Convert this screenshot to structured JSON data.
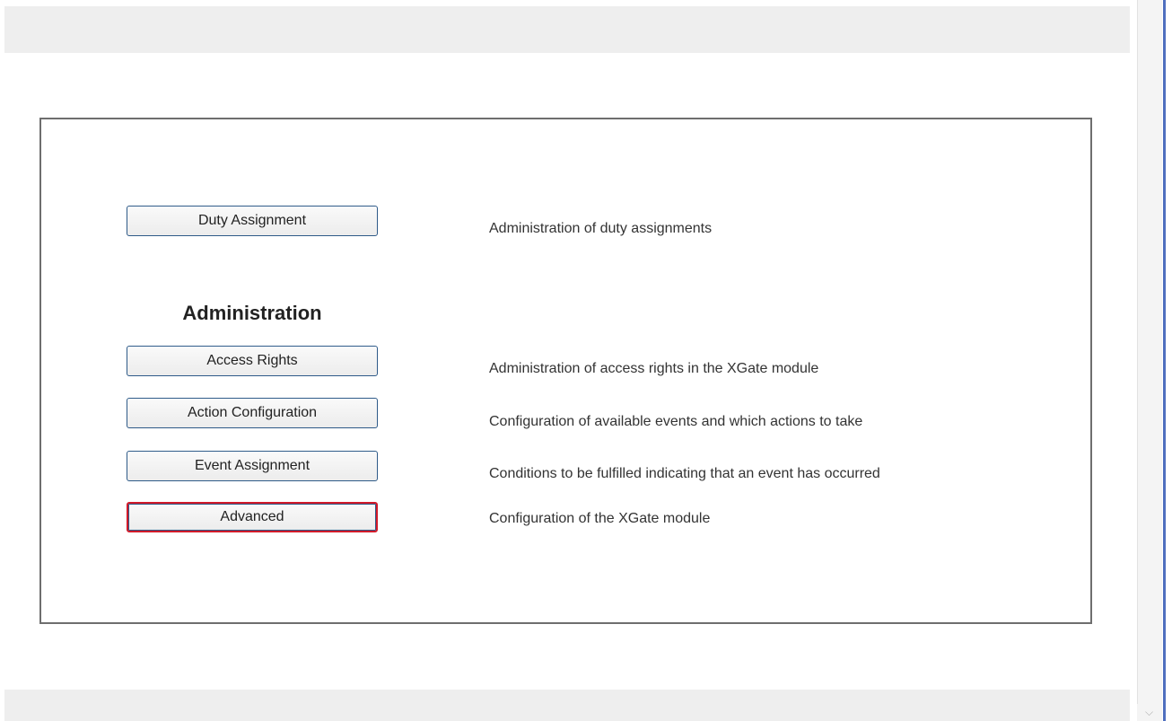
{
  "menu": {
    "items": [
      {
        "button_label": "Duty Assignment",
        "description": "Administration of duty assignments"
      }
    ]
  },
  "administration": {
    "heading": "Administration",
    "items": [
      {
        "button_label": "Access Rights",
        "description": "Administration of access rights in the XGate module"
      },
      {
        "button_label": "Action Configuration",
        "description": "Configuration of available events and which actions to take"
      },
      {
        "button_label": "Event Assignment",
        "description": "Conditions to be fulfilled indicating that an event has occurred"
      },
      {
        "button_label": "Advanced",
        "description": "Configuration of the XGate module",
        "focused": true
      }
    ]
  },
  "colors": {
    "bar_background": "#eeeeee",
    "panel_border": "#6e6e6e",
    "button_border": "#2e5a88",
    "focus_border": "#d11a2a",
    "window_edge": "#4f6fbf"
  },
  "icons": {
    "scroll_down": "chevron-down-icon"
  }
}
